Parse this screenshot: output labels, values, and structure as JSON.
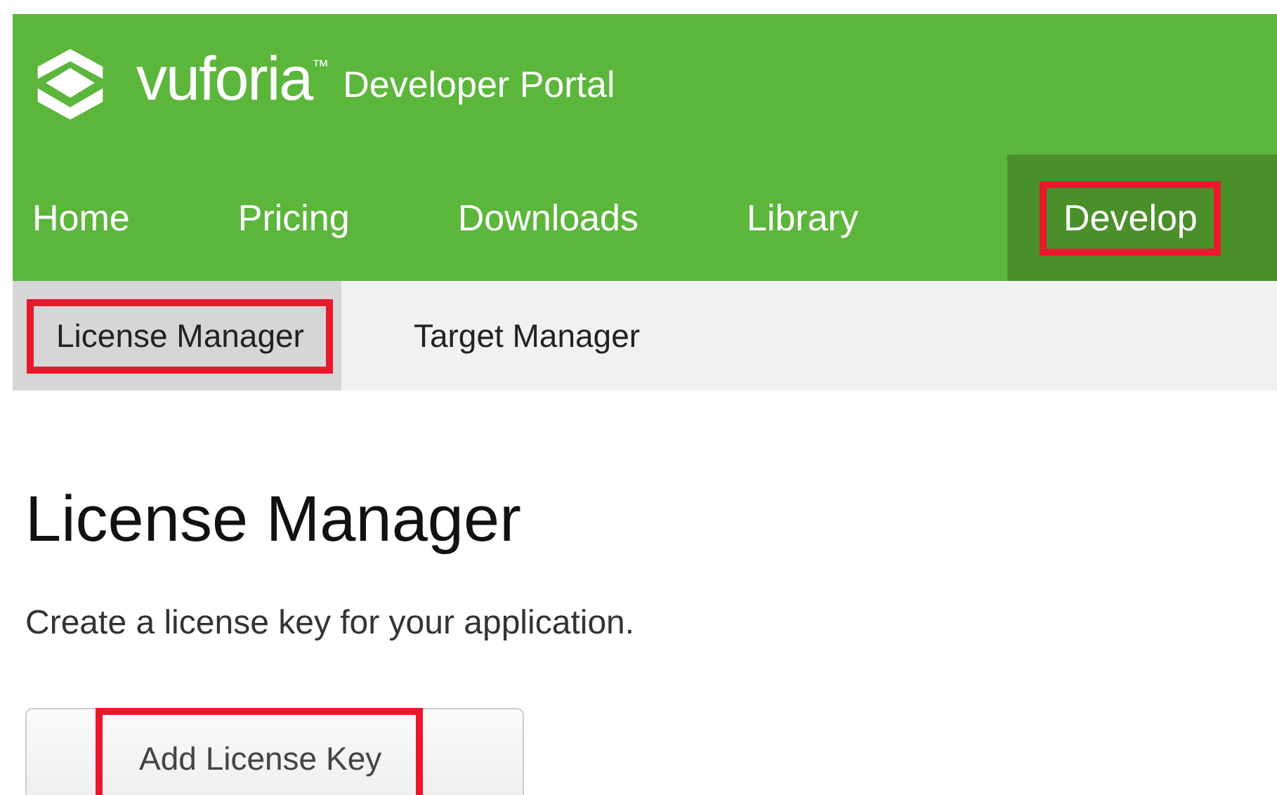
{
  "header": {
    "logo": "vuforia",
    "trademark": "™",
    "title": "Developer Portal"
  },
  "nav": [
    {
      "label": "Home",
      "selected": false,
      "highlighted": false
    },
    {
      "label": "Pricing",
      "selected": false,
      "highlighted": false
    },
    {
      "label": "Downloads",
      "selected": false,
      "highlighted": false
    },
    {
      "label": "Library",
      "selected": false,
      "highlighted": false
    },
    {
      "label": "Develop",
      "selected": true,
      "highlighted": true
    }
  ],
  "subnav": [
    {
      "label": "License Manager",
      "selected": true,
      "highlighted": true
    },
    {
      "label": "Target Manager",
      "selected": false,
      "highlighted": false
    }
  ],
  "page": {
    "heading": "License Manager",
    "description": "Create a license key for your application.",
    "button": {
      "label": "Add License Key",
      "highlighted": true
    }
  }
}
